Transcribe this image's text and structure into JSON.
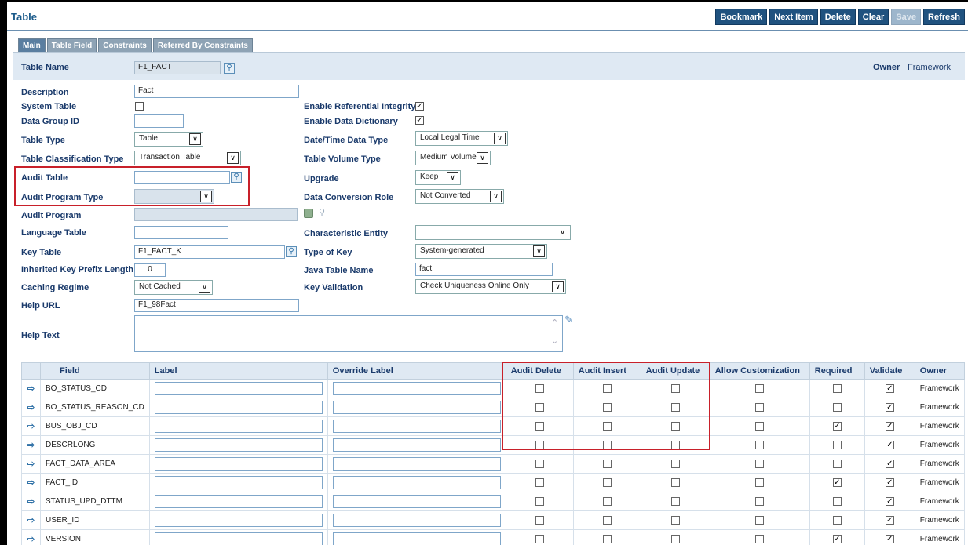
{
  "page": {
    "title": "Table"
  },
  "toolbar": {
    "bookmark": "Bookmark",
    "next_item": "Next Item",
    "delete": "Delete",
    "clear": "Clear",
    "save": "Save",
    "refresh": "Refresh"
  },
  "tabs": [
    "Main",
    "Table Field",
    "Constraints",
    "Referred By Constraints"
  ],
  "header": {
    "table_name_label": "Table Name",
    "table_name": "F1_FACT",
    "owner_label": "Owner",
    "owner": "Framework"
  },
  "labels": {
    "description": "Description",
    "system_table": "System Table",
    "data_group_id": "Data Group ID",
    "table_type": "Table Type",
    "table_classification_type": "Table Classification Type",
    "audit_table": "Audit Table",
    "audit_program_type": "Audit Program Type",
    "audit_program": "Audit Program",
    "language_table": "Language Table",
    "key_table": "Key Table",
    "inherited_key_prefix_length": "Inherited Key Prefix Length",
    "caching_regime": "Caching Regime",
    "help_url": "Help URL",
    "help_text": "Help Text",
    "enable_referential_integrity": "Enable Referential Integrity",
    "enable_data_dictionary": "Enable Data Dictionary",
    "date_time_data_type": "Date/Time Data Type",
    "table_volume_type": "Table Volume Type",
    "upgrade": "Upgrade",
    "data_conversion_role": "Data Conversion Role",
    "characteristic_entity": "Characteristic Entity",
    "type_of_key": "Type of Key",
    "java_table_name": "Java Table Name",
    "key_validation": "Key Validation"
  },
  "values": {
    "description": "Fact",
    "data_group_id": "",
    "table_type": "Table",
    "table_classification_type": "Transaction Table",
    "audit_table": "",
    "audit_program_type": "",
    "audit_program": "",
    "language_table": "",
    "key_table": "F1_FACT_K",
    "inherited_key_prefix_length": "0",
    "caching_regime": "Not Cached",
    "help_url": "F1_98Fact",
    "help_text": "",
    "date_time_data_type": "Local Legal Time",
    "table_volume_type": "Medium Volume",
    "upgrade": "Keep",
    "data_conversion_role": "Not Converted",
    "characteristic_entity": "",
    "type_of_key": "System-generated",
    "java_table_name": "fact",
    "key_validation": "Check Uniqueness Online Only",
    "system_table": false,
    "enable_referential_integrity": true,
    "enable_data_dictionary": true
  },
  "grid": {
    "columns": [
      "Field",
      "Label",
      "Override Label",
      "Audit Delete",
      "Audit Insert",
      "Audit Update",
      "Allow Customization",
      "Required",
      "Validate",
      "Owner"
    ],
    "rows": [
      {
        "field": "BO_STATUS_CD",
        "required": false,
        "validate": true,
        "owner": "Framework"
      },
      {
        "field": "BO_STATUS_REASON_CD",
        "required": false,
        "validate": true,
        "owner": "Framework"
      },
      {
        "field": "BUS_OBJ_CD",
        "required": true,
        "validate": true,
        "owner": "Framework"
      },
      {
        "field": "DESCRLONG",
        "required": false,
        "validate": true,
        "owner": "Framework"
      },
      {
        "field": "FACT_DATA_AREA",
        "required": false,
        "validate": true,
        "owner": "Framework"
      },
      {
        "field": "FACT_ID",
        "required": true,
        "validate": true,
        "owner": "Framework"
      },
      {
        "field": "STATUS_UPD_DTTM",
        "required": false,
        "validate": true,
        "owner": "Framework"
      },
      {
        "field": "USER_ID",
        "required": false,
        "validate": true,
        "owner": "Framework"
      },
      {
        "field": "VERSION",
        "required": true,
        "validate": true,
        "owner": "Framework"
      }
    ]
  }
}
